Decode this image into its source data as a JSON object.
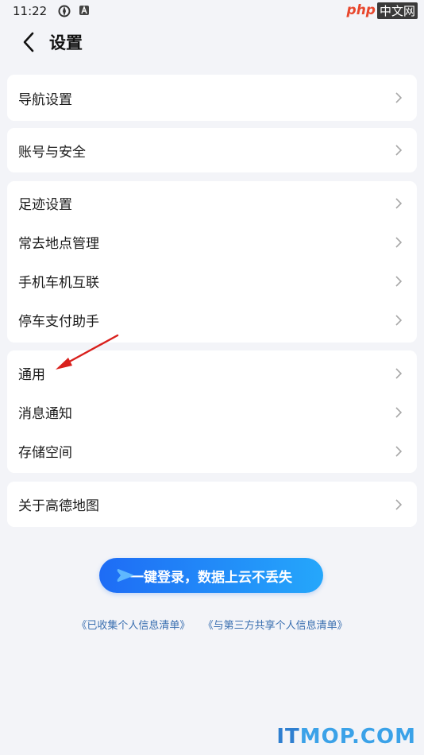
{
  "status_bar": {
    "time": "11:22",
    "icons": [
      "android-os-icon",
      "a-notification-icon"
    ]
  },
  "watermark_top": {
    "php": "php",
    "cn": "中文网"
  },
  "header": {
    "title": "设置"
  },
  "groups": [
    {
      "items": [
        {
          "label": "导航设置"
        }
      ]
    },
    {
      "items": [
        {
          "label": "账号与安全"
        }
      ]
    },
    {
      "items": [
        {
          "label": "足迹设置"
        },
        {
          "label": "常去地点管理"
        },
        {
          "label": "手机车机互联"
        },
        {
          "label": "停车支付助手"
        }
      ]
    },
    {
      "items": [
        {
          "label": "通用"
        },
        {
          "label": "消息通知"
        },
        {
          "label": "存储空间"
        }
      ]
    },
    {
      "items": [
        {
          "label": "关于高德地图"
        }
      ]
    }
  ],
  "login": {
    "label": "一键登录，数据上云不丢失"
  },
  "links": {
    "collected": "《已收集个人信息清单》",
    "shared": "《与第三方共享个人信息清单》"
  },
  "watermark_bottom": {
    "it": "IT",
    "mop": "MOP.COM"
  },
  "colors": {
    "accent_start": "#1e6cf5",
    "accent_end": "#25a7fb",
    "link": "#3a6fb0",
    "annotation": "#d9201c"
  }
}
